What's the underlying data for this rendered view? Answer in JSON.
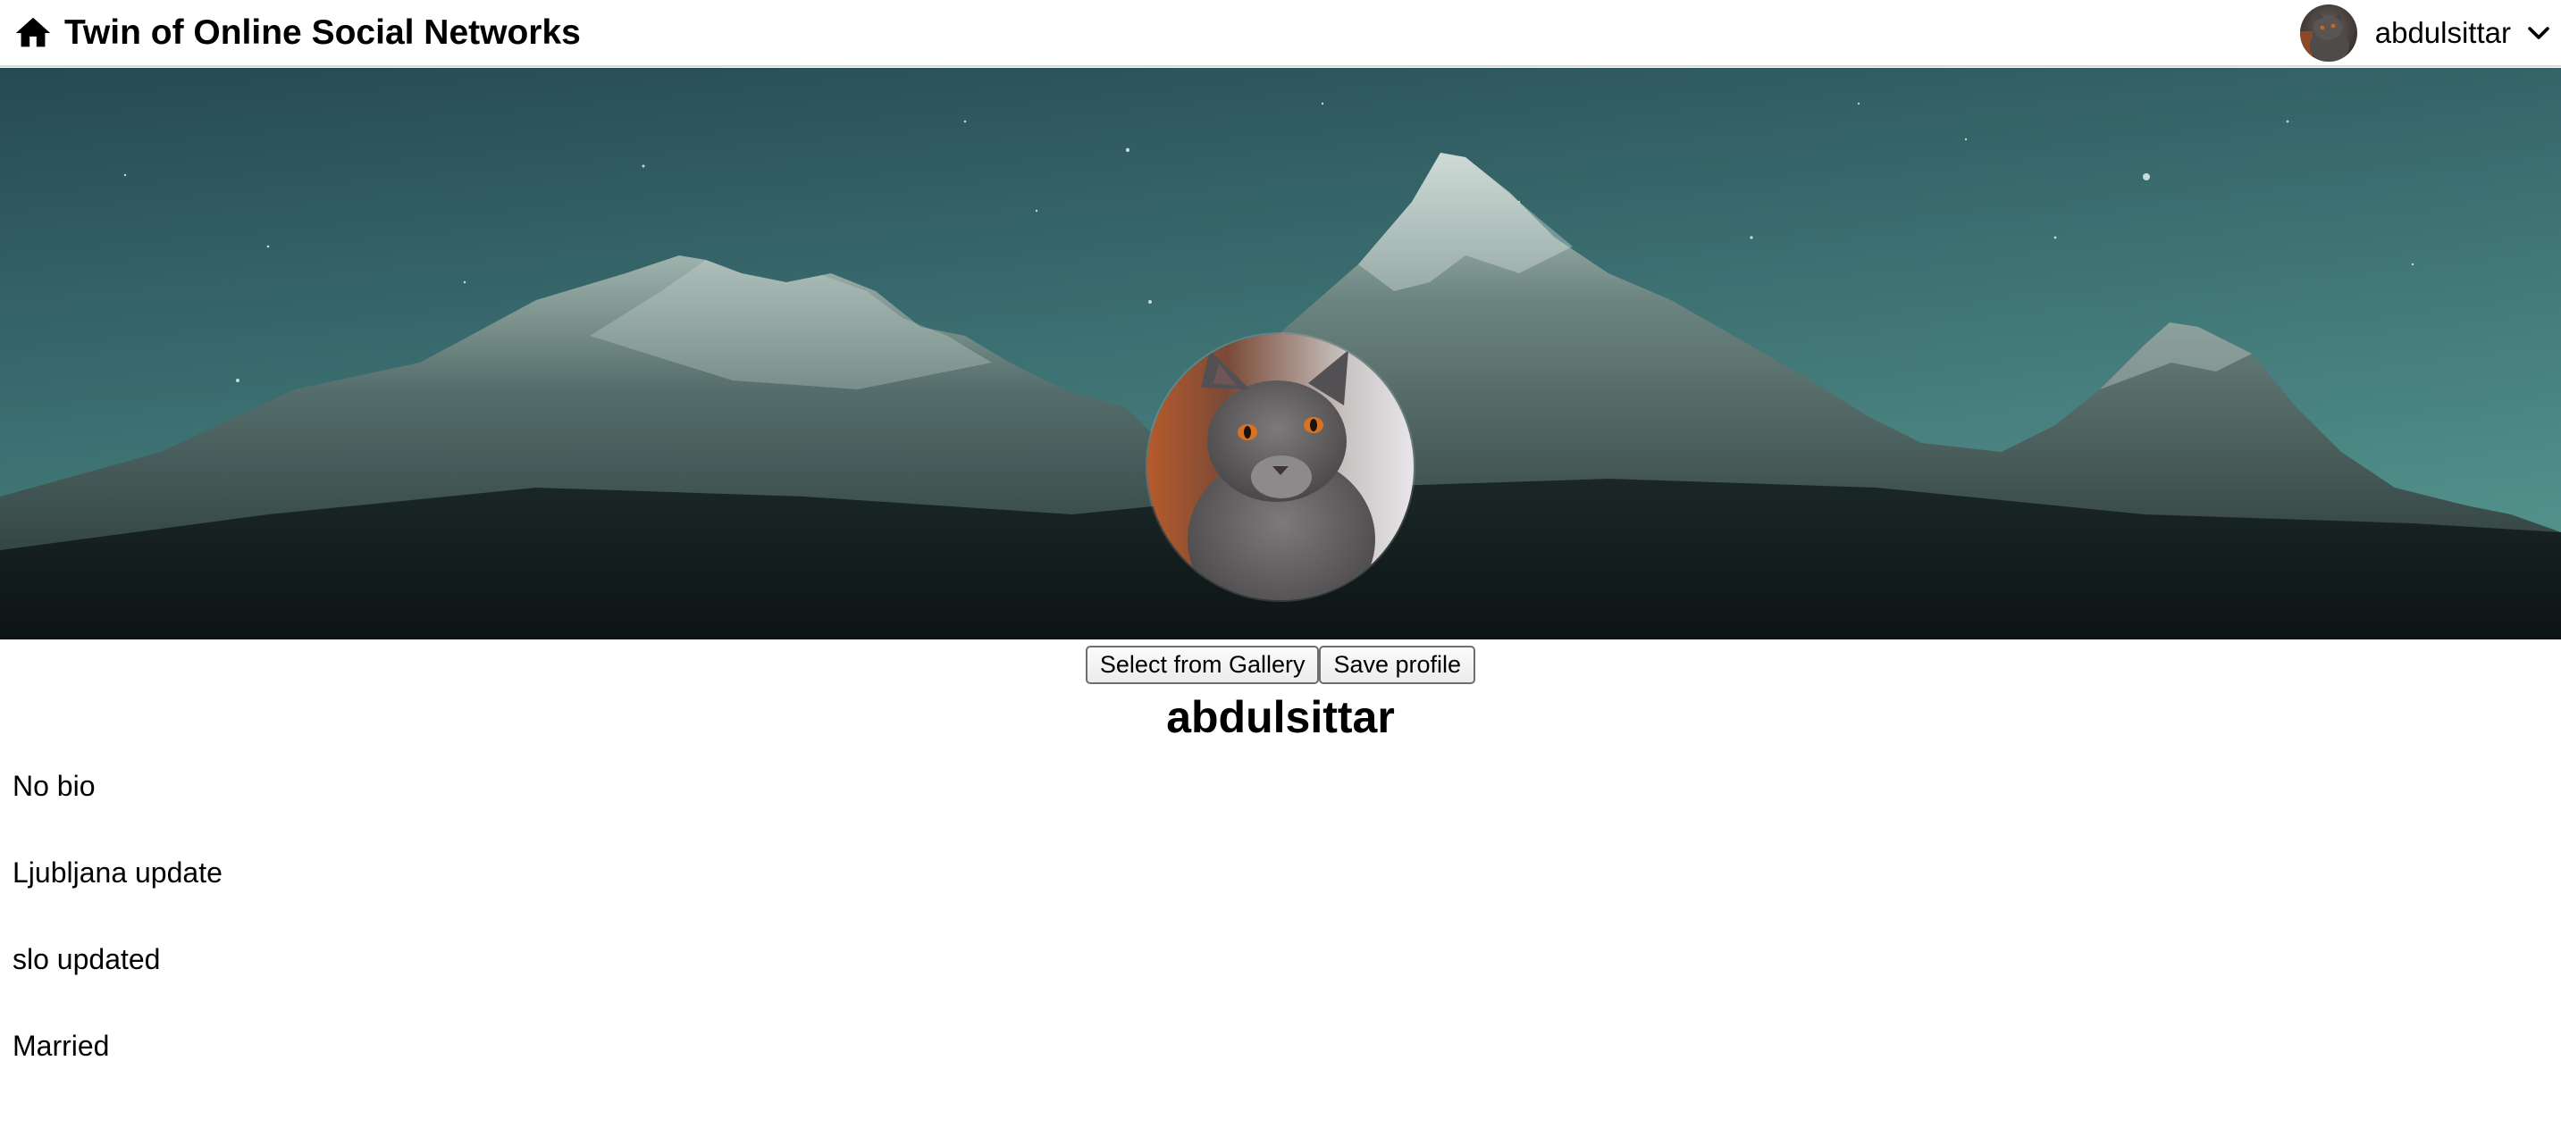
{
  "header": {
    "home_icon": "home-icon",
    "title": "Twin of Online Social Networks",
    "user": {
      "avatar_icon": "cat-avatar",
      "name": "abdulsittar",
      "menu_icon": "chevron-down-icon"
    }
  },
  "profile": {
    "cover_image": "night-mountain-range",
    "photo": "grey-cat-portrait",
    "buttons": {
      "gallery": "Select from Gallery",
      "save": "Save profile"
    },
    "username": "abdulsittar",
    "bio": "No bio",
    "city": "Ljubljana update",
    "country": "slo updated",
    "relationship": "Married"
  },
  "colors": {
    "sky_top": "#2a4f55",
    "sky_bottom": "#4a8582",
    "mountain_dark": "#10191b",
    "text": "#000000"
  }
}
